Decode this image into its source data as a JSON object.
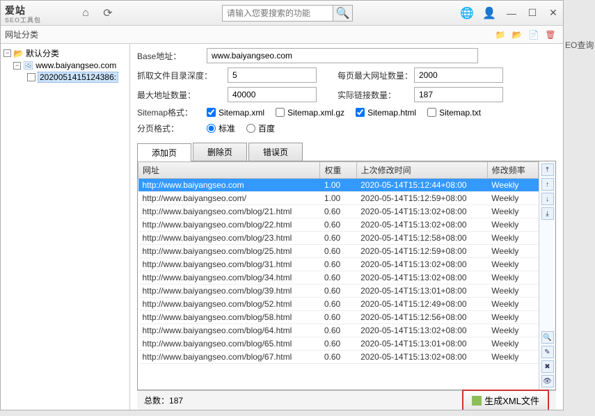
{
  "brand": {
    "name": "爱站",
    "sub": "SEO工具包"
  },
  "titlebar": {
    "search_placeholder": "请输入您要搜索的功能"
  },
  "toolbar2": {
    "label": "网址分类"
  },
  "tree": {
    "root": "默认分类",
    "site": "www.baiyangseo.com",
    "leaf": "2020051415124386:"
  },
  "form": {
    "base_label": "Base地址：",
    "base_value": "www.baiyangseo.com",
    "depth_label": "抓取文件目录深度：",
    "depth_value": "5",
    "perpage_label": "每页最大网址数量：",
    "perpage_value": "2000",
    "maxurl_label": "最大地址数量：",
    "maxurl_value": "40000",
    "actual_label": "实际链接数量：",
    "actual_value": "187",
    "sitemap_label": "Sitemap格式：",
    "sitemap_xml": "Sitemap.xml",
    "sitemap_xmlgz": "Sitemap.xml.gz",
    "sitemap_html": "Sitemap.html",
    "sitemap_txt": "Sitemap.txt",
    "page_label": "分页格式：",
    "page_std": "标准",
    "page_baidu": "百度"
  },
  "tabs": {
    "add": "添加页",
    "del": "删除页",
    "err": "错误页"
  },
  "grid": {
    "h_url": "网址",
    "h_weight": "权重",
    "h_time": "上次修改时间",
    "h_freq": "修改频率",
    "rows": [
      {
        "url": "http://www.baiyangseo.com",
        "w": "1.00",
        "t": "2020-05-14T15:12:44+08:00",
        "f": "Weekly"
      },
      {
        "url": "http://www.baiyangseo.com/",
        "w": "1.00",
        "t": "2020-05-14T15:12:59+08:00",
        "f": "Weekly"
      },
      {
        "url": "http://www.baiyangseo.com/blog/21.html",
        "w": "0.60",
        "t": "2020-05-14T15:13:02+08:00",
        "f": "Weekly"
      },
      {
        "url": "http://www.baiyangseo.com/blog/22.html",
        "w": "0.60",
        "t": "2020-05-14T15:13:02+08:00",
        "f": "Weekly"
      },
      {
        "url": "http://www.baiyangseo.com/blog/23.html",
        "w": "0.60",
        "t": "2020-05-14T15:12:58+08:00",
        "f": "Weekly"
      },
      {
        "url": "http://www.baiyangseo.com/blog/25.html",
        "w": "0.60",
        "t": "2020-05-14T15:12:59+08:00",
        "f": "Weekly"
      },
      {
        "url": "http://www.baiyangseo.com/blog/31.html",
        "w": "0.60",
        "t": "2020-05-14T15:13:02+08:00",
        "f": "Weekly"
      },
      {
        "url": "http://www.baiyangseo.com/blog/34.html",
        "w": "0.60",
        "t": "2020-05-14T15:13:02+08:00",
        "f": "Weekly"
      },
      {
        "url": "http://www.baiyangseo.com/blog/39.html",
        "w": "0.60",
        "t": "2020-05-14T15:13:01+08:00",
        "f": "Weekly"
      },
      {
        "url": "http://www.baiyangseo.com/blog/52.html",
        "w": "0.60",
        "t": "2020-05-14T15:12:49+08:00",
        "f": "Weekly"
      },
      {
        "url": "http://www.baiyangseo.com/blog/58.html",
        "w": "0.60",
        "t": "2020-05-14T15:12:56+08:00",
        "f": "Weekly"
      },
      {
        "url": "http://www.baiyangseo.com/blog/64.html",
        "w": "0.60",
        "t": "2020-05-14T15:13:02+08:00",
        "f": "Weekly"
      },
      {
        "url": "http://www.baiyangseo.com/blog/65.html",
        "w": "0.60",
        "t": "2020-05-14T15:13:01+08:00",
        "f": "Weekly"
      },
      {
        "url": "http://www.baiyangseo.com/blog/67.html",
        "w": "0.60",
        "t": "2020-05-14T15:13:02+08:00",
        "f": "Weekly"
      }
    ]
  },
  "status": {
    "total_label": "总数：",
    "total_value": "187",
    "gen_button": "生成XML文件"
  },
  "ext": {
    "query": "EO查询"
  }
}
